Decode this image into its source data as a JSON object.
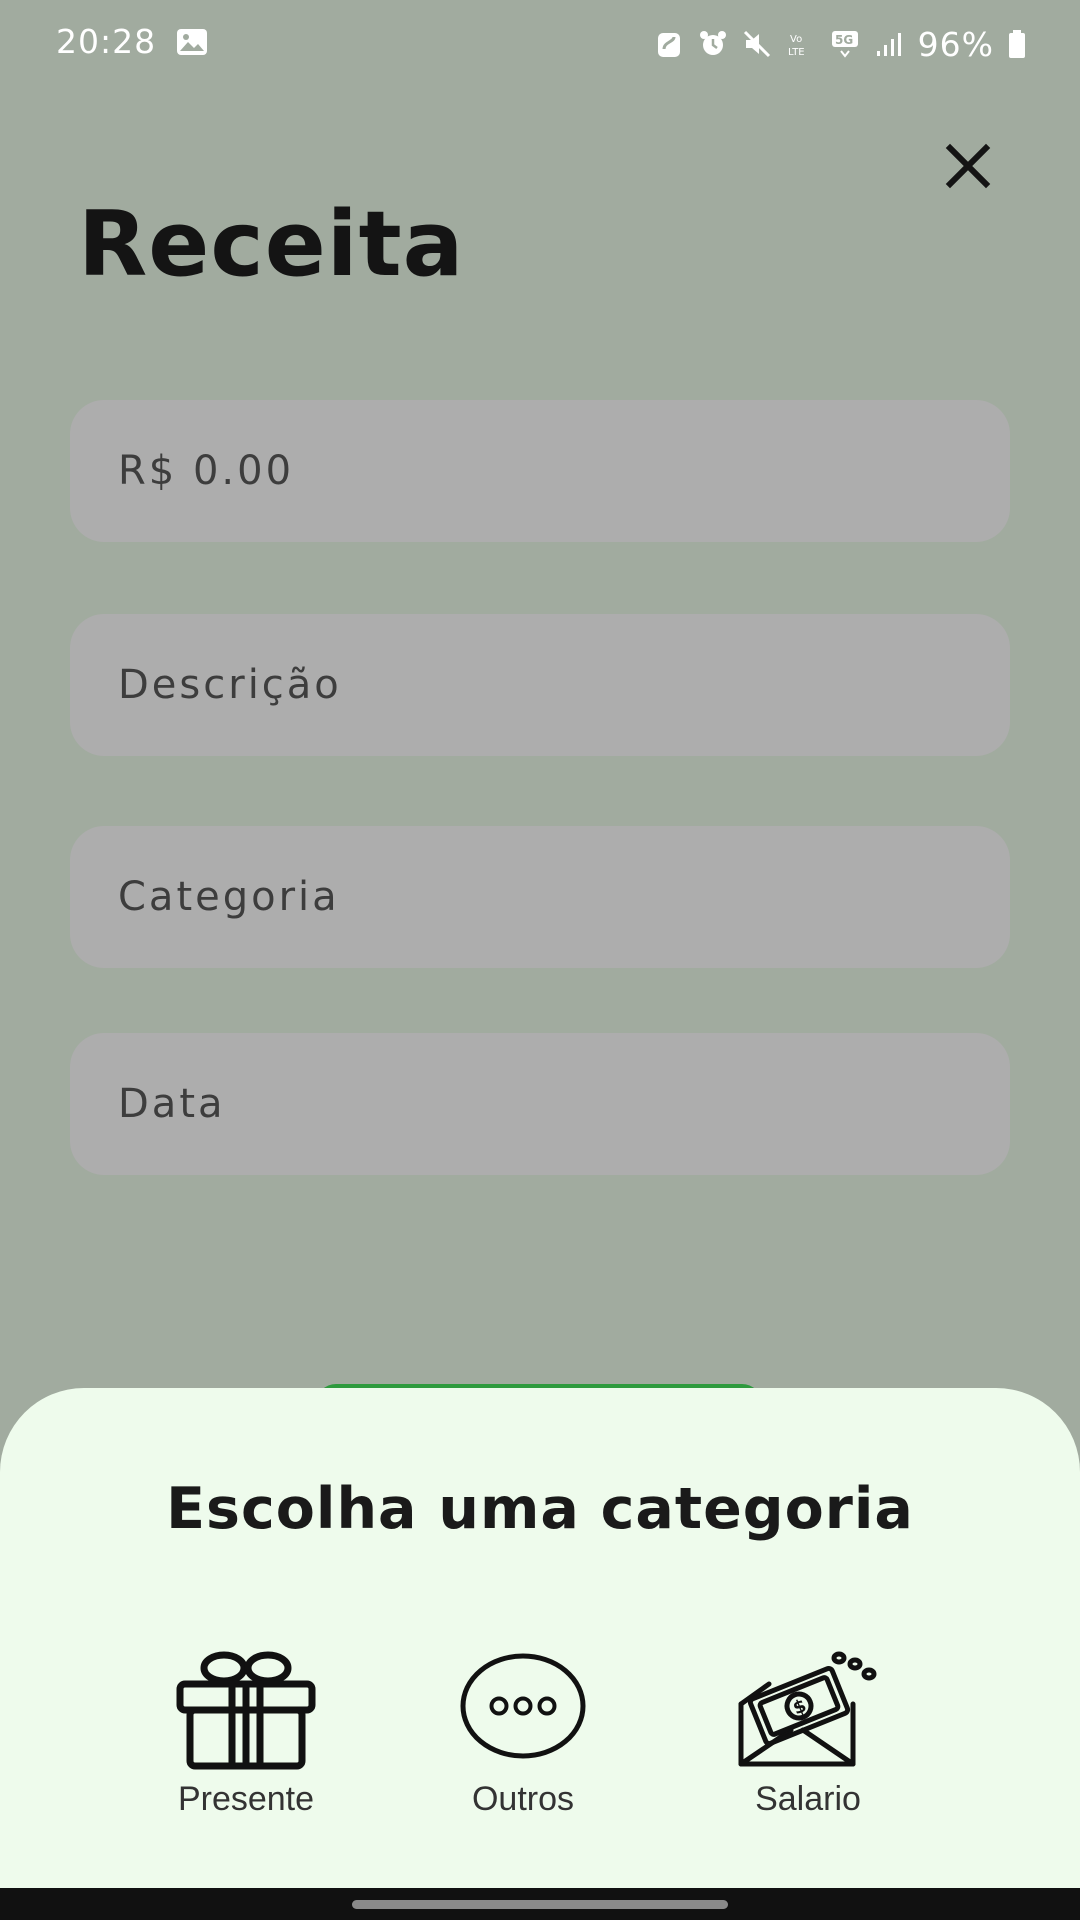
{
  "status_bar": {
    "time": "20:28",
    "battery": "96%",
    "icons": [
      "gallery-icon",
      "nfc-icon",
      "alarm-icon",
      "mute-icon",
      "volte-icon",
      "5g-icon",
      "signal-icon",
      "battery-icon"
    ]
  },
  "screen": {
    "title": "Receita",
    "close_icon": "close-icon"
  },
  "form": {
    "amount_placeholder": "R$ 0.00",
    "description_placeholder": "Descrição",
    "category_placeholder": "Categoria",
    "date_placeholder": "Data"
  },
  "sheet": {
    "title": "Escolha uma categoria",
    "categories": [
      {
        "label": "Presente",
        "icon": "gift-icon"
      },
      {
        "label": "Outros",
        "icon": "more-icon"
      },
      {
        "label": "Salario",
        "icon": "money-envelope-icon"
      }
    ]
  },
  "colors": {
    "background_dim": "#a1ab9f",
    "field": "#adadad",
    "sheet": "#eefbec",
    "accent": "#2e9a3e"
  }
}
